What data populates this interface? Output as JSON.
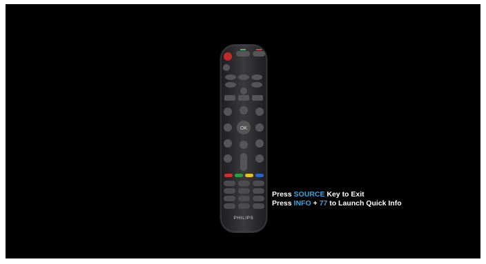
{
  "remote": {
    "brand": "PHILIPS",
    "keys": {
      "ok": "OK"
    },
    "color_keys": [
      "#d0312d",
      "#2e9e3f",
      "#e6c323",
      "#2a63c9"
    ]
  },
  "instructions": {
    "line1": {
      "prefix": "Press ",
      "key": "SOURCE",
      "suffix": " Key to Exit"
    },
    "line2": {
      "prefix": "Press ",
      "key": "INFO",
      "middle": " + ",
      "number": "77",
      "suffix": " to Launch Quick Info"
    }
  },
  "colors": {
    "background": "#000000",
    "highlight": "#2ea8e0",
    "remote_body": "#2d2d2f"
  }
}
